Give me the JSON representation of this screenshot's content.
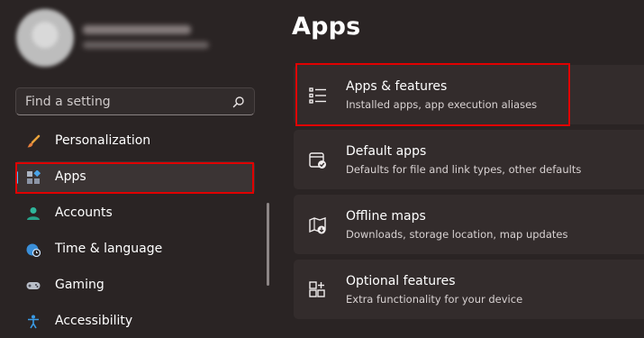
{
  "search": {
    "placeholder": "Find a setting"
  },
  "sidebar": {
    "items": [
      {
        "label": "Personalization",
        "icon": "brush-icon"
      },
      {
        "label": "Apps",
        "icon": "apps-icon"
      },
      {
        "label": "Accounts",
        "icon": "person-icon"
      },
      {
        "label": "Time & language",
        "icon": "globe-clock-icon"
      },
      {
        "label": "Gaming",
        "icon": "gamepad-icon"
      },
      {
        "label": "Accessibility",
        "icon": "accessibility-icon"
      }
    ]
  },
  "main": {
    "title": "Apps",
    "cards": [
      {
        "title": "Apps & features",
        "desc": "Installed apps, app execution aliases",
        "icon": "list-icon"
      },
      {
        "title": "Default apps",
        "desc": "Defaults for file and link types, other defaults",
        "icon": "default-apps-icon"
      },
      {
        "title": "Offline maps",
        "desc": "Downloads, storage location, map updates",
        "icon": "map-icon"
      },
      {
        "title": "Optional features",
        "desc": "Extra functionality for your device",
        "icon": "add-features-icon"
      }
    ]
  },
  "colors": {
    "accent": "#4cc2ff",
    "highlight": "#e00000",
    "background": "#2a2424",
    "card": "#332c2c"
  }
}
